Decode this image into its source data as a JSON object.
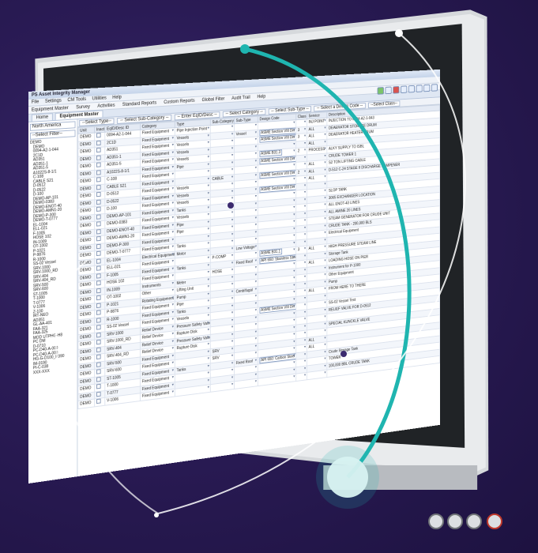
{
  "app": {
    "title": "PS Asset Integrity Manager",
    "menu": [
      "File",
      "Settings",
      "CM Tools",
      "Utilities",
      "Help"
    ],
    "toolbar": [
      "Equipment Master",
      "Survey",
      "Activities",
      "Standard Reports",
      "Custom Reports",
      "Global Filter",
      "Audit Trail",
      "Help"
    ],
    "tabs": [
      "Home",
      "Equipment Master"
    ],
    "sidebar": {
      "site": "North America",
      "filter": "--Select Filter--",
      "tree": [
        "DEMO",
        "DEMO",
        "0094-A2-1-044",
        "2C1D",
        "AD351",
        "AD351-1",
        "AD351-5",
        "A1022S-8-1/1",
        "C-108",
        "CABLE S21",
        "D-0512",
        "D-0522",
        "D-100",
        "DEMO-AP-101",
        "DEMO-0383",
        "DEMO-ENOT-40",
        "DEMO-AMN1-20",
        "DEMO-P-300",
        "DEMO-T-0777",
        "EL-1004",
        "ELL-021",
        "F-1005",
        "HOSE 102",
        "IN-1009",
        "OT-1002",
        "P-1021",
        "P-9876",
        "R-1000",
        "SS-02 Vessel",
        "SRV-1000",
        "SRV-1000_RD",
        "SRV-404",
        "SRV-404_RD",
        "SRV-500",
        "SRV-600",
        "ST-1005",
        "T-1000",
        "T-0777",
        "V-1006",
        "Z-100",
        "IRT-NEO",
        "AD351",
        "GL-AA-401",
        "FAA-321",
        "FAA-325",
        "MOD UTPHG-H8",
        "PC DM",
        "D-0710",
        "PC-D40-A-000",
        "PC-D40-A-000",
        "HG-G-D100_P390",
        "IM-0190",
        "PI-C-038",
        "XXX-XXX"
      ]
    },
    "filters": {
      "type": "--Select Type--",
      "sub_category": "-- Select Sub-Category --",
      "sub_type": "-- Select Sub-Type --",
      "enter_eqid": "-- Enter EqID/Desc --",
      "category": "-- Select Category --",
      "design_code": "-- Select a Design Code --",
      "class": "--Select Class--"
    },
    "columns": [
      "Unit",
      "Inactive",
      "EqID/Desc ID",
      "Category",
      "Type",
      "Sub-Category",
      "Sub-Type",
      "Design Code",
      "Class",
      "Service",
      "Description"
    ],
    "rows": [
      [
        "DEMO",
        "",
        "0094-A2-1-044",
        "Fixed Equipment",
        "Pipe Injection Point",
        "",
        "",
        "",
        "",
        "INJ POINT",
        "INJECTION TO 0094-A2-1-043"
      ],
      [
        "DEMO",
        "",
        "2C1D",
        "Fixed Equipment",
        "Vessels",
        "",
        "Vessel",
        "ASME Section VIII Div 1",
        "3",
        "ALL",
        "DEAERATOR STORAGE DRUM"
      ],
      [
        "DEMO",
        "",
        "AD351",
        "Fixed Equipment",
        "Vessels",
        "",
        "",
        "ASME Section VIII Div 1",
        "3",
        "ALL",
        "DEAERATOR HEATER DRUM"
      ],
      [
        "DEMO",
        "",
        "AD351-1",
        "Fixed Equipment",
        "Vessels",
        "",
        "",
        "",
        "",
        "ALL",
        ""
      ],
      [
        "DEMO",
        "",
        "AD351-5",
        "Fixed Equipment",
        "Vessels",
        "",
        "",
        "ASME B31.3",
        "2",
        "PROCESS",
        "ALKY SUPPLY TO ISBL"
      ],
      [
        "DEMO",
        "",
        "A1022S-8-1/1",
        "Fixed Equipment",
        "Pipe",
        "",
        "",
        "ASME Section VIII Div 1",
        "",
        "",
        "CRUDE TOWER 1"
      ],
      [
        "DEMO",
        "",
        "C-108",
        "Fixed Equipment",
        "",
        "",
        "",
        "",
        "",
        "ALL",
        "S2 TON LIFTING CABLE"
      ],
      [
        "DEMO",
        "",
        "CABLE S21",
        "Fixed Equipment",
        "",
        "CABLE",
        "",
        "ASME Section VIII Div 1",
        "2",
        "ALL",
        "D-512 C-24 STAGE II DISCHARGE DAMPENER"
      ],
      [
        "DEMO",
        "",
        "D-0512",
        "Fixed Equipment",
        "Vessels",
        "",
        "",
        "",
        "",
        "ALL",
        ""
      ],
      [
        "DEMO",
        "",
        "D-0522",
        "Fixed Equipment",
        "Vessels",
        "",
        "",
        "ASME Section VIII Div 1",
        "",
        "",
        ""
      ],
      [
        "DEMO",
        "",
        "D-100",
        "Fixed Equipment",
        "Vessels",
        "",
        "",
        "",
        "",
        "",
        "SLOP TANK"
      ],
      [
        "DEMO",
        "",
        "DEMO-AP-101",
        "Fixed Equipment",
        "Tanks",
        "",
        "",
        "",
        "",
        "",
        "3065 EXCHANGER LOCATION"
      ],
      [
        "DEMO",
        "",
        "DEMO-0383",
        "Fixed Equipment",
        "Vessels",
        "",
        "",
        "",
        "",
        "",
        "ALL ENOT-40 LINES"
      ],
      [
        "DEMO",
        "",
        "DEMO-ENOT-40",
        "Fixed Equipment",
        "Pipe",
        "",
        "",
        "",
        "",
        "",
        "ALL AMINE 20 LINES"
      ],
      [
        "DEMO",
        "",
        "DEMO-AMN1-20",
        "Fixed Equipment",
        "Pipe",
        "",
        "",
        "",
        "",
        "",
        "STEAM GENERATOR FOR CRUDE UNIT"
      ],
      [
        "DEMO",
        "",
        "DEMO-P-300",
        "Fixed Equipment",
        "",
        "",
        "",
        "",
        "",
        "",
        "CRUDE TANK - 200,000 BLS"
      ],
      [
        "DEMO",
        "",
        "DEMO-T-0777",
        "Fixed Equipment",
        "Tanks",
        "",
        "",
        "",
        "",
        "",
        "Electrical Equipment"
      ],
      [
        "DEMO",
        "",
        "EL-1004",
        "Electrical Equipment",
        "Motor",
        "",
        "Low Voltage",
        "",
        "",
        "",
        ""
      ],
      [
        "DEMO",
        "",
        "ELL-021",
        "Fixed Equipment",
        "",
        "P-COMP",
        "",
        "ASME B31.1",
        "3",
        "ALL",
        "HIGH PRESSURE STEAM LINE"
      ],
      [
        "DEMO",
        "",
        "F-1005",
        "Fixed Equipment",
        "Tanks",
        "",
        "Fixed Roof",
        "API 650: Stainless Steel",
        "",
        "",
        "Storage Tank"
      ],
      [
        "DEMO",
        "",
        "HOSE 102",
        "Fixed Equipment",
        "",
        "HOSE",
        "",
        "",
        "",
        "ALL",
        "LOADING HOSE ON PIER"
      ],
      [
        "DEMO",
        "",
        "IN-1009",
        "Instruments",
        "Meter",
        "",
        "",
        "",
        "",
        "",
        "Instrument for P-1000"
      ],
      [
        "DEMO",
        "",
        "OT-1002",
        "Other",
        "Lifting Unit",
        "",
        "",
        "",
        "",
        "",
        "Other Equipment"
      ],
      [
        "DEMO",
        "",
        "P-1021",
        "Rotating Equipment",
        "Pump",
        "",
        "Centrifugal",
        "",
        "",
        "",
        "Pump"
      ],
      [
        "DEMO",
        "",
        "P-9876",
        "Fixed Equipment",
        "Pipe",
        "",
        "",
        "",
        "",
        "ALL",
        "FROM HERE TO THERE"
      ],
      [
        "DEMO",
        "",
        "R-1000",
        "Fixed Equipment",
        "Tanks",
        "",
        "",
        "",
        "",
        "",
        ""
      ],
      [
        "DEMO",
        "",
        "SS-02 Vessel",
        "Fixed Equipment",
        "Vessels",
        "",
        "",
        "ASME Section VIII Div 2",
        "",
        "",
        "SS-02 Vessel Test"
      ],
      [
        "DEMO",
        "",
        "SRV-1000",
        "Relief Device",
        "Pressure Safety Valve",
        "",
        "",
        "",
        "",
        "",
        "RELIEF VALVE FOR D-0512"
      ],
      [
        "DEMO",
        "",
        "SRV-1000_RD",
        "Relief Device",
        "Rupture Disk",
        "",
        "",
        "",
        "",
        "",
        ""
      ],
      [
        "DEMO",
        "",
        "SRV-404",
        "Relief Device",
        "Pressure Safety Valve",
        "",
        "",
        "",
        "",
        "",
        "SPECIAL KUNCKLE VALVE"
      ],
      [
        "DEMO",
        "",
        "SRV-404_RD",
        "Relief Device",
        "Rupture Disk",
        "",
        "",
        "",
        "",
        "",
        ""
      ],
      [
        "DEMO",
        "",
        "SRV-500",
        "Fixed Equipment",
        "",
        "SRV",
        "",
        "",
        "",
        "ALL",
        ""
      ],
      [
        "DEMO",
        "",
        "SRV-600",
        "Fixed Equipment",
        "",
        "SRV",
        "",
        "",
        "",
        "ALL",
        ""
      ],
      [
        "DEMO",
        "",
        "ST-1005",
        "Fixed Equipment",
        "Tanks",
        "",
        "Fixed Roof",
        "API 650: Carbon Steel",
        "",
        "",
        "Crude Storage Tank"
      ],
      [
        "DEMO",
        "",
        "T-1000",
        "Fixed Equipment",
        "",
        "",
        "",
        "",
        "",
        "",
        "TOWER"
      ],
      [
        "DEMO",
        "",
        "T-0777",
        "Fixed Equipment",
        "",
        "",
        "",
        "",
        "",
        "",
        "100,000 BBL CRUDE TANK"
      ],
      [
        "DEMO",
        "",
        "V-1006",
        "Fixed Equipment",
        "",
        "",
        "",
        "",
        "",
        "",
        ""
      ]
    ]
  },
  "colors": {
    "accent": "#1fb5b0",
    "background": "#2a1b55",
    "bezel": "#d7dadd"
  }
}
